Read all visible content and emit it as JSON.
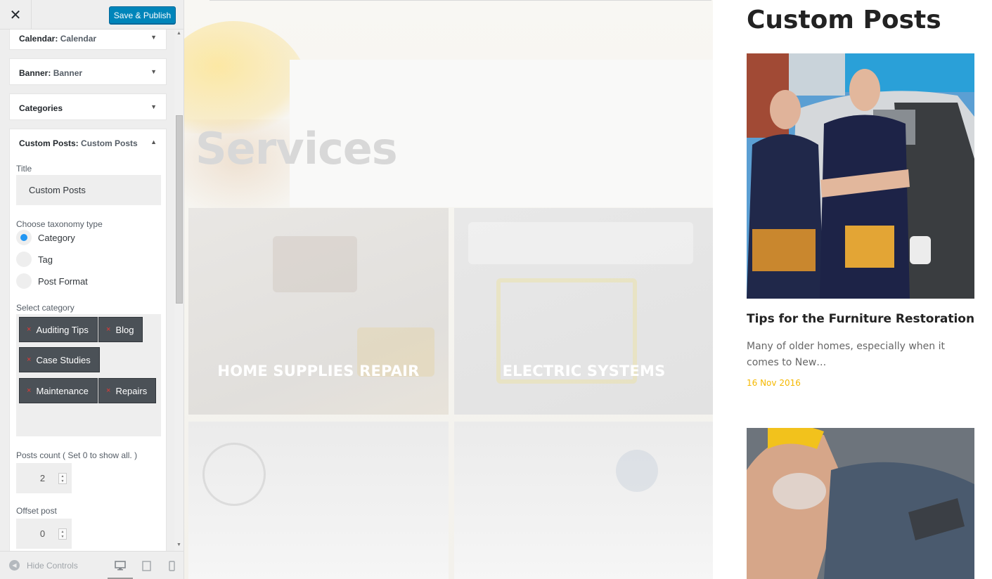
{
  "topbar": {
    "close_glyph": "✕",
    "publish_label": "Save & Publish"
  },
  "sections": [
    {
      "title": "Calendar:",
      "subtitle": "Calendar"
    },
    {
      "title": "Banner:",
      "subtitle": "Banner"
    },
    {
      "title": "Categories",
      "subtitle": ""
    },
    {
      "title": "Custom Posts:",
      "subtitle": "Custom Posts"
    }
  ],
  "widget": {
    "title_label": "Title",
    "title_value": "Custom Posts",
    "taxonomy_label": "Choose taxonomy type",
    "taxonomy_options": [
      "Category",
      "Tag",
      "Post Format"
    ],
    "taxonomy_selected": "Category",
    "select_category_label": "Select category",
    "selected_categories": [
      "Auditing Tips",
      "Blog",
      "Case Studies",
      "Maintenance",
      "Repairs"
    ],
    "remove_glyph": "×",
    "posts_count_label": "Posts count ( Set 0 to show all. )",
    "posts_count_value": "2",
    "offset_label": "Offset post",
    "offset_value": "0"
  },
  "footer": {
    "hide_controls_label": "Hide Controls"
  },
  "preview": {
    "services_title": "Services",
    "tiles": [
      "HOME SUPPLIES REPAIR",
      "ELECTRIC SYSTEMS",
      "",
      ""
    ],
    "posts_heading": "Custom Posts",
    "posts": [
      {
        "title": "Tips for the Furniture Restoration",
        "excerpt": "Many of older homes, especially when it comes to New…",
        "date": "16 Nov 2016"
      }
    ]
  },
  "colors": {
    "accent": "#0085ba",
    "radio": "#2196f3",
    "chip": "#4b5157",
    "date": "#f5b800"
  }
}
